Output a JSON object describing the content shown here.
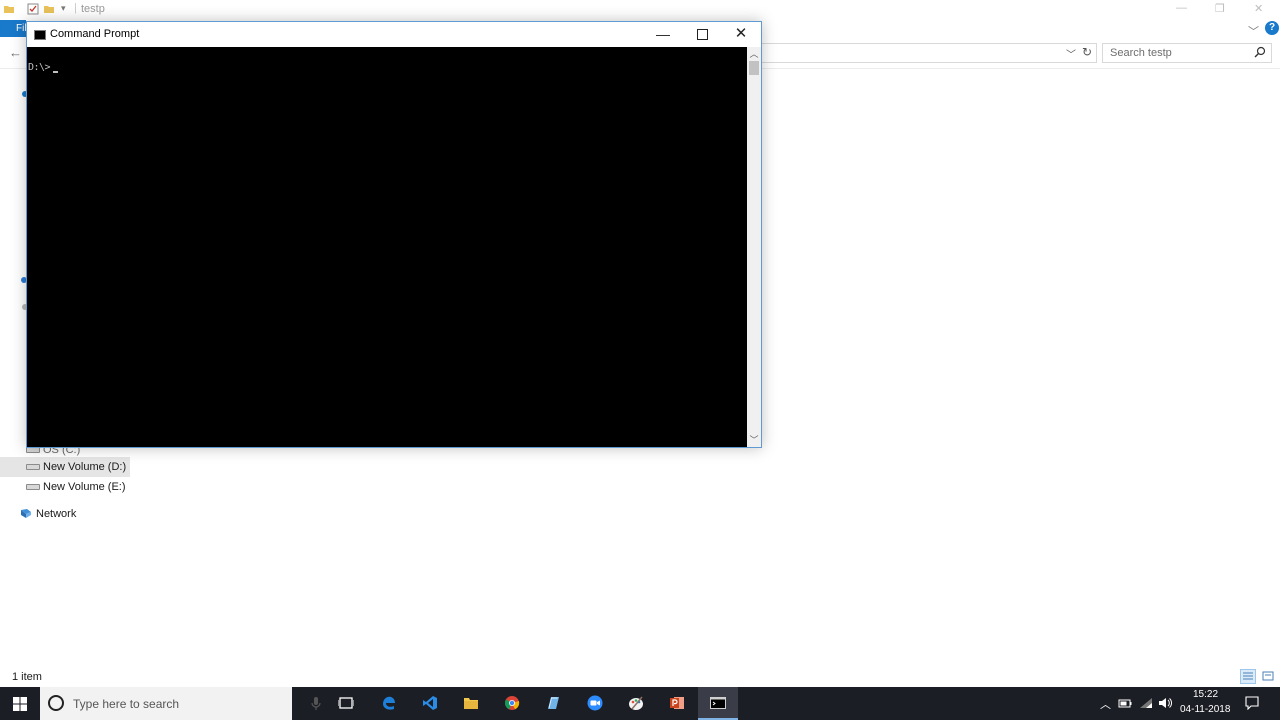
{
  "explorer": {
    "title": "testp",
    "ribbon_file_tab": "File",
    "search_placeholder": "Search testp",
    "nav": {
      "drive_c": "OS (C:)",
      "drive_d": "New Volume (D:)",
      "drive_e": "New Volume (E:)",
      "network": "Network"
    },
    "status": "1 item"
  },
  "cmd": {
    "title": "Command Prompt",
    "prompt": "D:\\>"
  },
  "taskbar": {
    "search_placeholder": "Type here to search",
    "apps": [
      "task-view-icon",
      "edge-icon",
      "vscode-icon",
      "file-explorer-icon",
      "chrome-icon",
      "notes-icon",
      "zoom-icon",
      "paint-icon",
      "powerpoint-icon",
      "command-prompt-icon"
    ],
    "clock_time": "15:22",
    "clock_date": "04-11-2018"
  },
  "colors": {
    "accent": "#1979ca",
    "taskbar": "#1c1e26",
    "console_bg": "#000000",
    "console_text": "#c0c0c0"
  }
}
